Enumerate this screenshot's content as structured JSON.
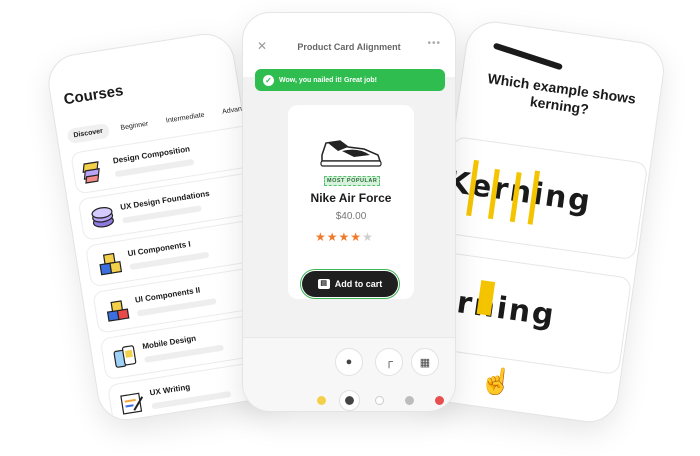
{
  "courses_screen": {
    "title": "Courses",
    "tabs": [
      "Discover",
      "Beginner",
      "Intermediate",
      "Advanced"
    ],
    "active_tab": 0,
    "items": [
      {
        "name": "Design Composition",
        "icon": "layers-icon"
      },
      {
        "name": "UX Design Foundations",
        "icon": "stack-icon"
      },
      {
        "name": "UI Components I",
        "icon": "blocks-icon"
      },
      {
        "name": "UI Components II",
        "icon": "blocks-icon"
      },
      {
        "name": "Mobile Design",
        "icon": "phones-icon"
      },
      {
        "name": "UX Writing",
        "icon": "writing-icon"
      }
    ]
  },
  "product_screen": {
    "title": "Product Card Alignment",
    "toast": "Wow, you nailed it! Great job!",
    "card": {
      "badge": "MOST POPULAR",
      "name": "Nike Air Force",
      "price": "$40.00",
      "rating": 4,
      "rating_max": 5,
      "button": "Add to cart"
    },
    "tools": [
      "drop-icon",
      "corner-radius-icon",
      "shadow-icon"
    ],
    "swatches": [
      "#f3d04a",
      "#444444",
      "#ffffff",
      "#bdbdbd",
      "#e85050"
    ],
    "colors": {
      "success": "#2fbd4f",
      "star": "#f07a2b"
    }
  },
  "quiz_screen": {
    "question": "Which example shows kerning?",
    "option_1": "Kerning",
    "option_2": "Kerning",
    "accent": "#f5c400"
  }
}
